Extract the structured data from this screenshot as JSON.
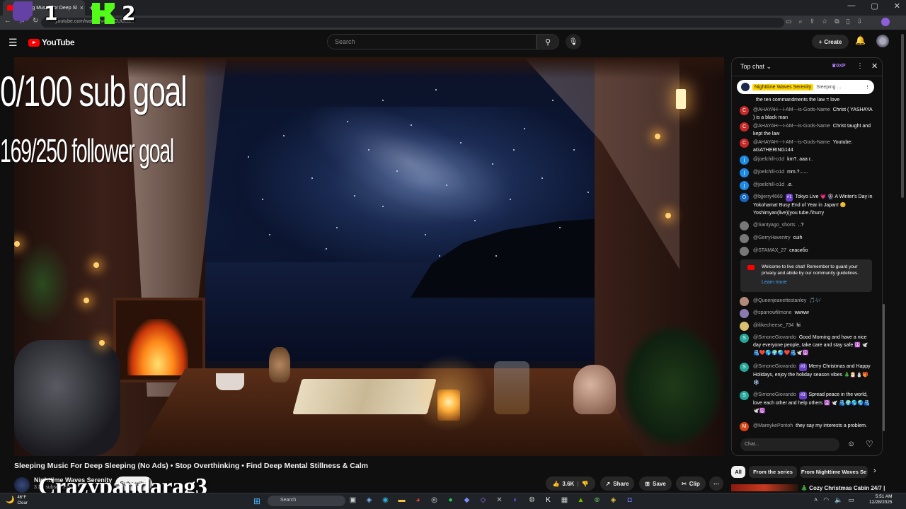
{
  "browser": {
    "tab_title": "Sleeping Music For Deep Sl",
    "url": "youtube.com/watch?v=...UCUCLa..."
  },
  "overlay": {
    "num1": "1",
    "num2": "2",
    "goal1": "0/100 sub goal",
    "goal2": "169/250 follower goal",
    "streamer_name": "Crazypandarag3"
  },
  "header": {
    "logo": "YouTube",
    "search_placeholder": "Search",
    "create_label": "Create"
  },
  "video": {
    "title": "Sleeping Music For Deep Sleeping (No Ads) • Stop Overthinking • Find Deep Mental Stillness & Calm",
    "channel": "Nighttime Waves Serenity",
    "subscribers": "3.3K subscribers",
    "subscribe_label": "Subscribe",
    "likes": "3.6K",
    "share_label": "Share",
    "save_label": "Save",
    "clip_label": "Clip"
  },
  "chat": {
    "header_label": "Top chat",
    "xp_label": "0XP",
    "pinned": {
      "author": "Nighttime Waves Serenity",
      "text": "Sleeping ..."
    },
    "messages": [
      {
        "author": "",
        "text": "the ten commandments the law = love",
        "initial": "",
        "color": "#c62828"
      },
      {
        "author": "@AHAYAH---I-AM---is-Gods-Name",
        "text": "Christ ( YASHAYA ) is a black man",
        "initial": "C",
        "color": "#c62828"
      },
      {
        "author": "@AHAYAH---I-AM---is-Gods-Name",
        "text": "Christ taught and kept the law",
        "initial": "C",
        "color": "#c62828"
      },
      {
        "author": "@AHAYAH---I-AM---is-Gods-Name",
        "text": "Youtube: aGATHERING144",
        "initial": "C",
        "color": "#c62828"
      },
      {
        "author": "@joelchill-o1d",
        "text": "km?. aaa r..",
        "initial": "j",
        "color": "#1e88e5"
      },
      {
        "author": "@joelchill-o1d",
        "text": "mm.?......",
        "initial": "j",
        "color": "#1e88e5"
      },
      {
        "author": "@joelchill-o1d",
        "text": ".e.",
        "initial": "j",
        "color": "#1e88e5"
      },
      {
        "author": "@bjjerry4669",
        "badge": "#1",
        "text": "Tokyo Live 💗 🎡 A Winter's Day in Yokohama! Busy End of Year in Japan! 😊 Yoshimyan(live)(you tube./\\hurry",
        "initial": "O",
        "color": "#1565c0"
      },
      {
        "author": "@Santyago_shorts",
        "text": "..?",
        "initial": "",
        "color": "#777"
      },
      {
        "author": "@GerryHaventry",
        "text": "cuih",
        "initial": "",
        "color": "#777"
      },
      {
        "author": "@STAMAX_27",
        "text": "спасибо",
        "initial": "",
        "color": "#777"
      },
      {
        "author": "@Queenjeanettestanley",
        "text": "🎵🎶",
        "initial": "",
        "color": "#b08a7a"
      },
      {
        "author": "@sparrowfilmone",
        "text": "wwww",
        "initial": "",
        "color": "#8a7ab0"
      },
      {
        "author": "@ilikecheese_734",
        "text": "hi",
        "initial": "",
        "color": "#d8c070"
      },
      {
        "author": "@SimoneGiovando",
        "text": "Good Morning and have a nice day everyone people, take care and stay safe ☮️ 🕊️🫂❤️🌎🌍🌏❤️🫂🕊️☮️",
        "initial": "S",
        "color": "#26a69a"
      },
      {
        "author": "@SimoneGiovando",
        "badge": "#3",
        "text": "Merry Christmas and Happy Holidays, enjoy the holiday season vibes 🎄🎅⛄🎁❄️",
        "initial": "S",
        "color": "#26a69a"
      },
      {
        "author": "@SimoneGiovando",
        "badge": "#3",
        "text": "Spread peace in the world, love each other and help others ☮️ 🕊️ 🫂🌍🌎🌏🫂🕊️☮️",
        "initial": "S",
        "color": "#26a69a"
      },
      {
        "author": "@MareykePontoh",
        "text": "they say my interests a problem.",
        "initial": "M",
        "color": "#d84315"
      }
    ],
    "welcome_text": "Welcome to live chat! Remember to guard your privacy and abide by our community guidelines.",
    "learn_more": "Learn more",
    "input_placeholder": "Chat..."
  },
  "chips": {
    "all": "All",
    "series": "From the series",
    "from": "From Nighttime Waves Se"
  },
  "recommendation": {
    "title": "🎄 Cozy Christmas Cabin 24/7 |"
  },
  "taskbar": {
    "temp": "46°F",
    "weather": "Clear",
    "search": "Search",
    "time": "5:51 AM",
    "date": "12/28/2025"
  }
}
